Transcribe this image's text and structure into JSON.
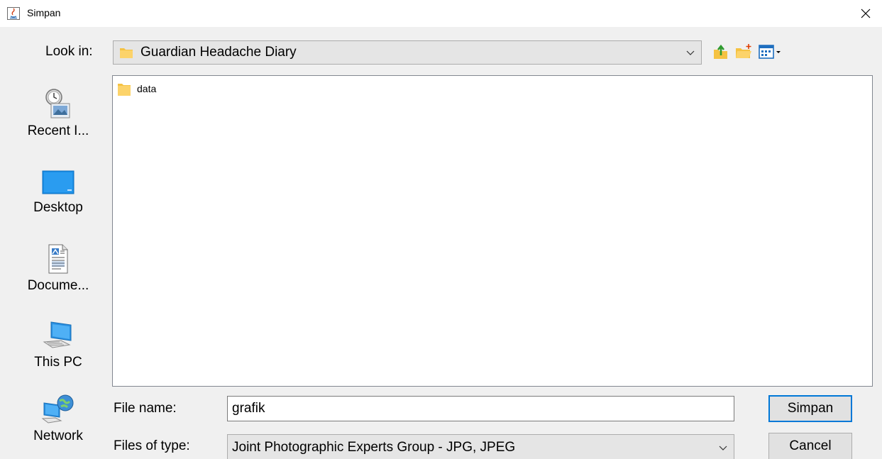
{
  "window": {
    "title": "Simpan"
  },
  "lookin": {
    "label": "Look in:",
    "value": "Guardian Headache Diary"
  },
  "places": [
    {
      "label": "Recent I...",
      "icon": "recent-items-icon"
    },
    {
      "label": "Desktop",
      "icon": "desktop-icon"
    },
    {
      "label": "Docume...",
      "icon": "documents-icon"
    },
    {
      "label": "This PC",
      "icon": "this-pc-icon"
    },
    {
      "label": "Network",
      "icon": "network-icon"
    }
  ],
  "files": [
    {
      "name": "data",
      "icon": "folder-icon"
    }
  ],
  "filename": {
    "label": "File name:",
    "value": "grafik"
  },
  "filetype": {
    "label": "Files of type:",
    "value": "Joint Photographic Experts Group - JPG, JPEG"
  },
  "buttons": {
    "save": "Simpan",
    "cancel": "Cancel"
  },
  "colors": {
    "accent": "#0078d7",
    "folder": "#f5c242",
    "background": "#f0f0f0"
  }
}
